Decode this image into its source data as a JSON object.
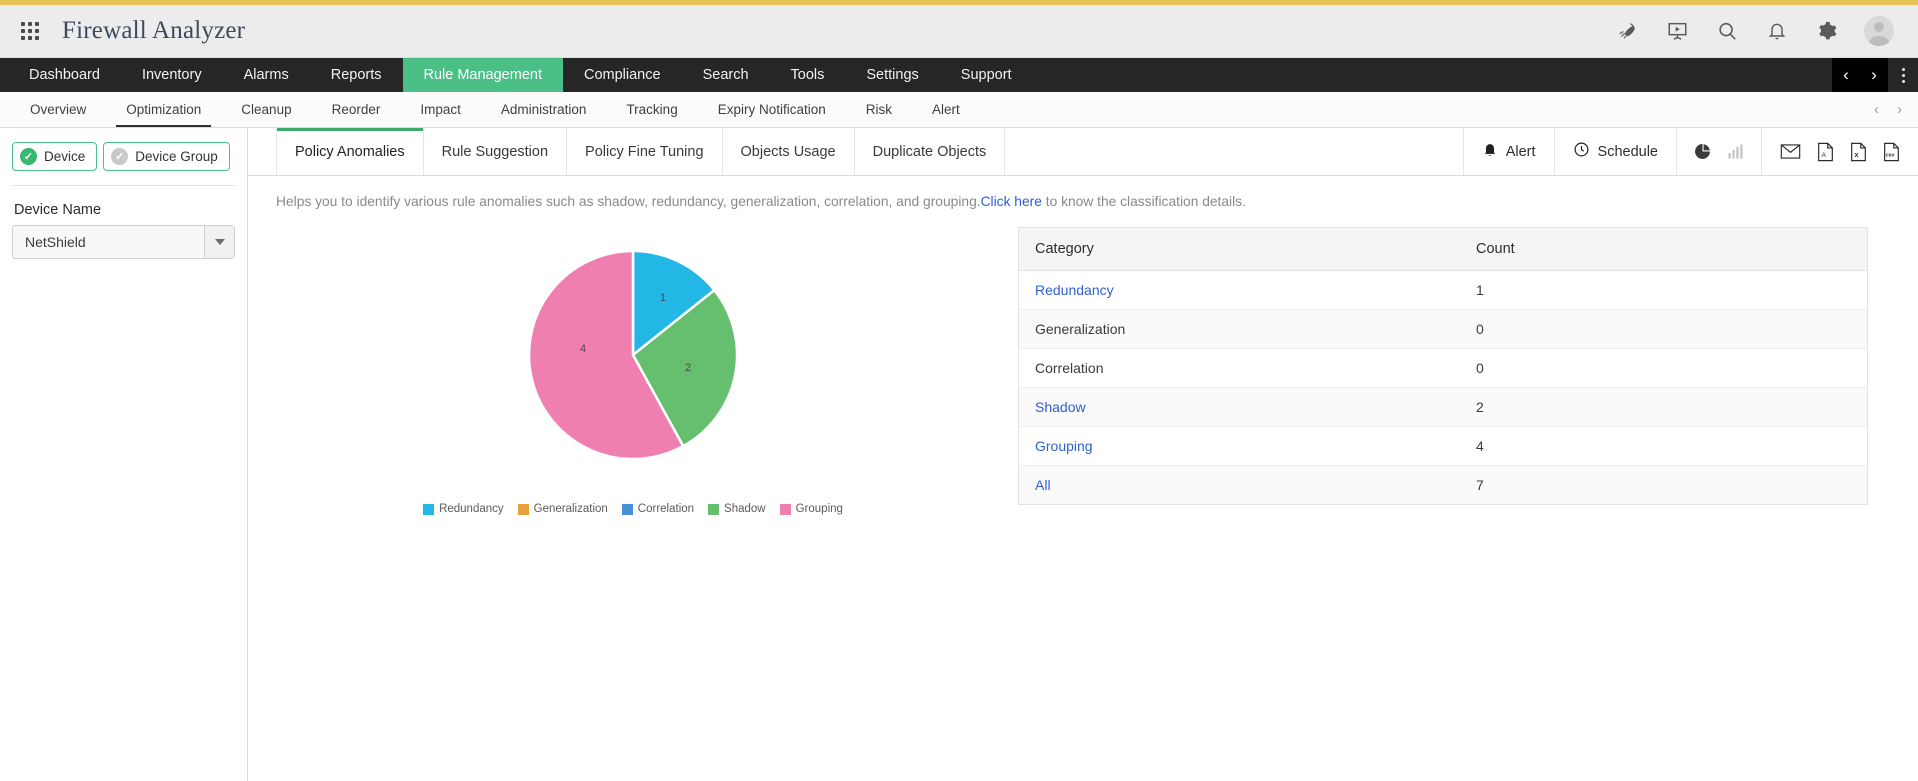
{
  "header": {
    "title": "Firewall Analyzer",
    "grid_icon": "apps-grid-icon",
    "icons": [
      {
        "name": "rocket-icon",
        "label": "Rocket"
      },
      {
        "name": "presentation-icon",
        "label": "Demo"
      },
      {
        "name": "search-icon",
        "label": "Search"
      },
      {
        "name": "bell-icon",
        "label": "Notifications"
      },
      {
        "name": "gear-icon",
        "label": "Settings"
      },
      {
        "name": "avatar-icon",
        "label": "Profile"
      }
    ]
  },
  "main_nav": {
    "items": [
      {
        "label": "Dashboard",
        "active": false
      },
      {
        "label": "Inventory",
        "active": false
      },
      {
        "label": "Alarms",
        "active": false
      },
      {
        "label": "Reports",
        "active": false
      },
      {
        "label": "Rule Management",
        "active": true
      },
      {
        "label": "Compliance",
        "active": false
      },
      {
        "label": "Search",
        "active": false
      },
      {
        "label": "Tools",
        "active": false
      },
      {
        "label": "Settings",
        "active": false
      },
      {
        "label": "Support",
        "active": false
      }
    ],
    "prev_arrow": "‹",
    "next_arrow": "›",
    "active_color": "#4cbf87"
  },
  "sub_nav": {
    "items": [
      {
        "label": "Overview",
        "active": false
      },
      {
        "label": "Optimization",
        "active": true
      },
      {
        "label": "Cleanup",
        "active": false
      },
      {
        "label": "Reorder",
        "active": false
      },
      {
        "label": "Impact",
        "active": false
      },
      {
        "label": "Administration",
        "active": false
      },
      {
        "label": "Tracking",
        "active": false
      },
      {
        "label": "Expiry Notification",
        "active": false
      },
      {
        "label": "Risk",
        "active": false
      },
      {
        "label": "Alert",
        "active": false
      }
    ],
    "prev_arrow": "‹",
    "next_arrow": "›"
  },
  "sidebar": {
    "device_button": {
      "label": "Device",
      "selected": true
    },
    "device_group_button": {
      "label": "Device Group",
      "selected": false
    },
    "device_name_label": "Device Name",
    "device_select_value": "NetShield"
  },
  "tabs": [
    {
      "label": "Policy Anomalies",
      "active": true
    },
    {
      "label": "Rule Suggestion",
      "active": false
    },
    {
      "label": "Policy Fine Tuning",
      "active": false
    },
    {
      "label": "Objects Usage",
      "active": false
    },
    {
      "label": "Duplicate Objects",
      "active": false
    }
  ],
  "toolbar": {
    "alert_label": "Alert",
    "schedule_label": "Schedule",
    "chart_icons": [
      {
        "name": "pie-chart-icon",
        "active": true
      },
      {
        "name": "bar-chart-icon",
        "active": false
      }
    ],
    "export_icons": [
      {
        "name": "email-icon"
      },
      {
        "name": "pdf-icon"
      },
      {
        "name": "excel-icon"
      },
      {
        "name": "csv-icon"
      }
    ]
  },
  "description": {
    "text_before": "Helps you to identify various rule anomalies such as shadow, redundancy, generalization, correlation, and grouping.",
    "link_text": "Click here",
    "text_after": " to know the classification details."
  },
  "table": {
    "headers": [
      "Category",
      "Count"
    ],
    "rows": [
      {
        "category": "Redundancy",
        "count": "1",
        "link": true
      },
      {
        "category": "Generalization",
        "count": "0",
        "link": false
      },
      {
        "category": "Correlation",
        "count": "0",
        "link": false
      },
      {
        "category": "Shadow",
        "count": "2",
        "link": true
      },
      {
        "category": "Grouping",
        "count": "4",
        "link": true
      },
      {
        "category": "All",
        "count": "7",
        "link": true
      }
    ]
  },
  "chart_data": {
    "type": "pie",
    "title": "",
    "categories": [
      "Redundancy",
      "Generalization",
      "Correlation",
      "Shadow",
      "Grouping"
    ],
    "values": [
      1,
      0,
      0,
      2,
      4
    ],
    "colors": [
      "#23b7e5",
      "#eaa13c",
      "#4a90d9",
      "#65bf6e",
      "#ef7fae"
    ],
    "data_labels": [
      "1",
      "2",
      "4"
    ],
    "total": 7,
    "legend_position": "bottom",
    "legend": [
      "Redundancy",
      "Generalization",
      "Correlation",
      "Shadow",
      "Grouping"
    ]
  }
}
